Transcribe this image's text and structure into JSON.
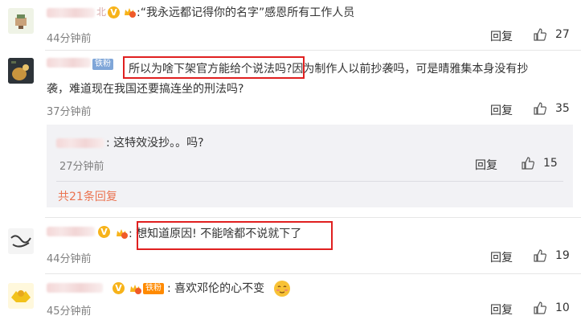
{
  "comments": [
    {
      "text": "“我永远都记得你的名字”感恩所有工作人员",
      "prefix": ":",
      "time": "44分钟前",
      "reply": "回复",
      "likes": "27",
      "name_visible": "北"
    },
    {
      "text_line1": "所以为啥下架官方能给个说法吗?因为制作人以前抄袭吗，可是晴雅集本身没有抄",
      "text_line2": "袭，难道现在我国还要搞连坐的刑法吗?",
      "time": "37分钟前",
      "reply": "回复",
      "likes": "35",
      "badge": "铁粉"
    },
    {
      "text": "这特效没抄。。吗?",
      "time": "27分钟前",
      "reply": "回复",
      "likes": "15",
      "more": "共21条回复"
    },
    {
      "text": "想知道原因! 不能啥都不说就下了",
      "time": "44分钟前",
      "reply": "回复",
      "likes": "19"
    },
    {
      "text": "喜欢邓伦的心不变",
      "time": "45分钟前",
      "reply": "回复",
      "likes": "10",
      "badge": "铁粉"
    }
  ],
  "colors": {
    "accent": "#eb7350",
    "highlight_box": "#e02020",
    "badge_v": "#f7b31a",
    "badge_tiefen": "#ff8a00"
  },
  "icons": [
    "thumbs-up-icon",
    "v-verified-icon",
    "crown-icon"
  ]
}
